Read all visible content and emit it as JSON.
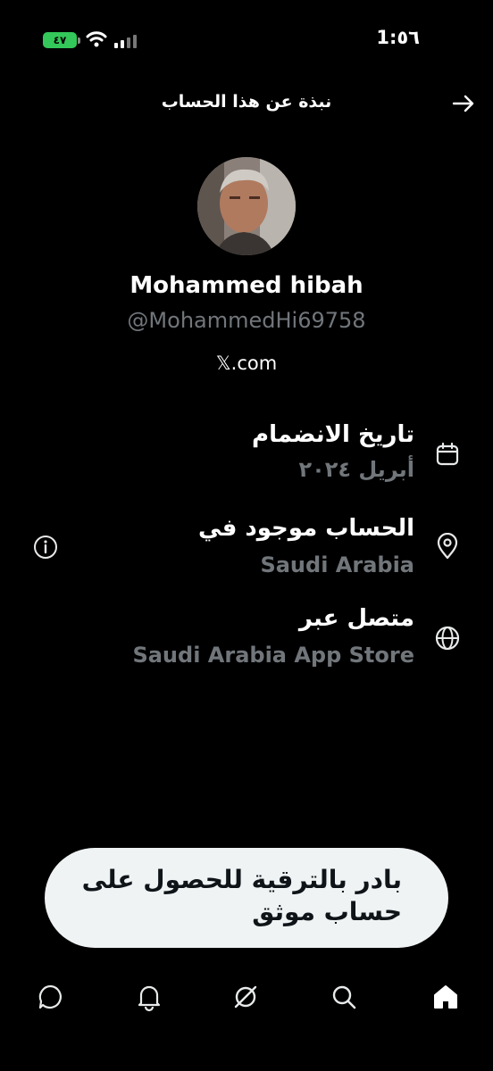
{
  "status_bar": {
    "time": "1:٥٦",
    "battery": "٤٧"
  },
  "header": {
    "title": "نبذة عن هذا الحساب"
  },
  "profile": {
    "display_name": "Mohammed hibah",
    "handle": "@MohammedHi69758",
    "site": "𝕏.com"
  },
  "info": [
    {
      "title": "تاريخ الانضمام",
      "value": "أبريل ٢٠٢٤",
      "icon": "calendar-icon"
    },
    {
      "title": "الحساب موجود في",
      "value": "Saudi Arabia",
      "icon": "location-pin-icon"
    },
    {
      "title": "متصل عبر",
      "value": "Saudi Arabia App Store",
      "icon": "globe-icon"
    }
  ],
  "upgrade": {
    "label": "بادر بالترقية للحصول على حساب موثق"
  },
  "nav": [
    "home-icon",
    "search-icon",
    "grok-icon",
    "notifications-icon",
    "messages-icon"
  ]
}
